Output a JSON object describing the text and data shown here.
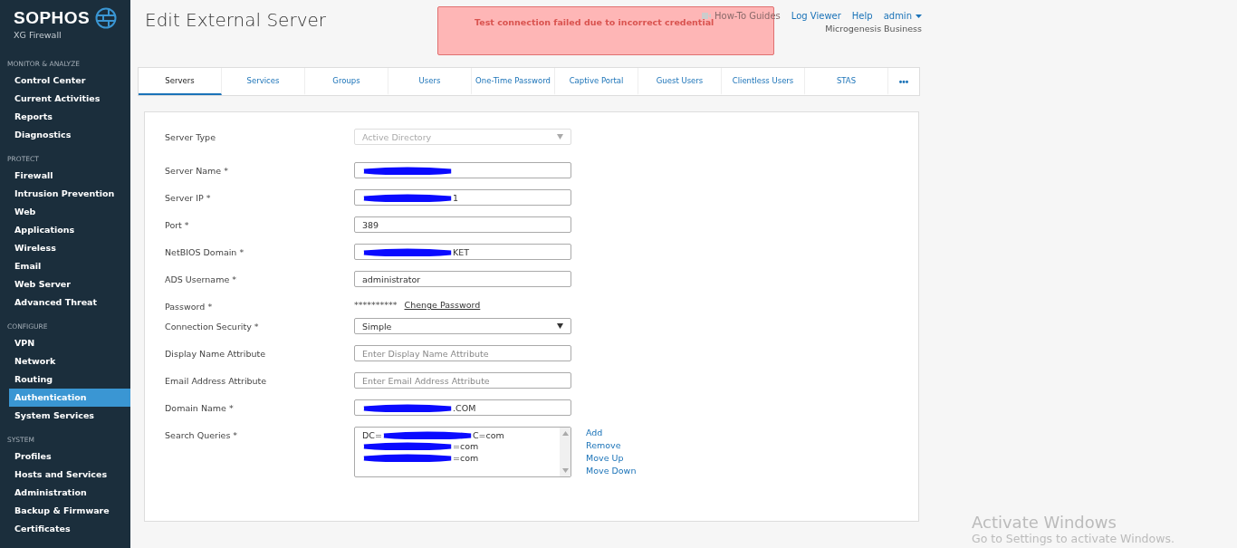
{
  "brand": {
    "name": "SOPHOS",
    "product": "XG Firewall"
  },
  "sidebar": {
    "sections": [
      {
        "title": "MONITOR & ANALYZE",
        "items": [
          {
            "label": "Control Center",
            "selected": false
          },
          {
            "label": "Current Activities",
            "selected": false
          },
          {
            "label": "Reports",
            "selected": false
          },
          {
            "label": "Diagnostics",
            "selected": false
          }
        ]
      },
      {
        "title": "PROTECT",
        "items": [
          {
            "label": "Firewall",
            "selected": false
          },
          {
            "label": "Intrusion Prevention",
            "selected": false
          },
          {
            "label": "Web",
            "selected": false
          },
          {
            "label": "Applications",
            "selected": false
          },
          {
            "label": "Wireless",
            "selected": false
          },
          {
            "label": "Email",
            "selected": false
          },
          {
            "label": "Web Server",
            "selected": false
          },
          {
            "label": "Advanced Threat",
            "selected": false
          }
        ]
      },
      {
        "title": "CONFIGURE",
        "items": [
          {
            "label": "VPN",
            "selected": false
          },
          {
            "label": "Network",
            "selected": false
          },
          {
            "label": "Routing",
            "selected": false
          },
          {
            "label": "Authentication",
            "selected": true
          },
          {
            "label": "System Services",
            "selected": false
          }
        ]
      },
      {
        "title": "SYSTEM",
        "items": [
          {
            "label": "Profiles",
            "selected": false
          },
          {
            "label": "Hosts and Services",
            "selected": false
          },
          {
            "label": "Administration",
            "selected": false
          },
          {
            "label": "Backup & Firmware",
            "selected": false
          },
          {
            "label": "Certificates",
            "selected": false
          }
        ]
      }
    ]
  },
  "page_title": "Edit External Server",
  "header": {
    "links": [
      "How-To Guides",
      "Log Viewer",
      "Help"
    ],
    "user": "admin",
    "company": "Microgenesis Business"
  },
  "toast": {
    "message": "Test connection failed due to incorrect credential"
  },
  "tabs": [
    {
      "label": "Servers",
      "selected": true
    },
    {
      "label": "Services",
      "selected": false
    },
    {
      "label": "Groups",
      "selected": false
    },
    {
      "label": "Users",
      "selected": false
    },
    {
      "label": "One-Time Password",
      "selected": false
    },
    {
      "label": "Captive Portal",
      "selected": false
    },
    {
      "label": "Guest Users",
      "selected": false
    },
    {
      "label": "Clientless Users",
      "selected": false
    },
    {
      "label": "STAS",
      "selected": false
    }
  ],
  "more_tabs": "•••",
  "form": [
    {
      "kind": "select",
      "label": "Server Type",
      "value": "Active Directory",
      "disabled": true
    },
    {
      "kind": "text",
      "label": "Server Name *",
      "parts": [
        {
          "kind": "redacted"
        }
      ]
    },
    {
      "kind": "text",
      "label": "Server IP *",
      "parts": [
        {
          "kind": "redacted"
        },
        {
          "kind": "text",
          "text": "1"
        }
      ]
    },
    {
      "kind": "text",
      "label": "Port *",
      "parts": [
        {
          "kind": "text",
          "text": "389"
        }
      ]
    },
    {
      "kind": "text",
      "label": "NetBIOS Domain *",
      "parts": [
        {
          "kind": "redacted"
        },
        {
          "kind": "text",
          "text": "KET"
        }
      ]
    },
    {
      "kind": "text",
      "label": "ADS Username *",
      "parts": [
        {
          "kind": "text",
          "text": "administrator"
        }
      ]
    },
    {
      "kind": "password",
      "label": "Password *",
      "value": "**********",
      "link": "Chenge Password"
    },
    {
      "kind": "select",
      "label": "Connection Security *",
      "value": "Simple",
      "disabled": false
    },
    {
      "kind": "text",
      "label": "Display Name Attribute",
      "placeholder": "Enter Display Name Attribute"
    },
    {
      "kind": "text",
      "label": "Email Address Attribute",
      "placeholder": "Enter Email Address Attribute"
    },
    {
      "kind": "text",
      "label": "Domain Name *",
      "parts": [
        {
          "kind": "redacted"
        },
        {
          "kind": "text",
          "text": ".COM"
        }
      ]
    },
    {
      "kind": "list",
      "label": "Search Queries *",
      "lines": [
        [
          {
            "kind": "text",
            "text": "DC="
          },
          {
            "kind": "redacted"
          },
          {
            "kind": "text",
            "text": "C=com"
          }
        ],
        [
          {
            "kind": "redacted"
          },
          {
            "kind": "text",
            "text": "=com"
          }
        ],
        [
          {
            "kind": "redacted"
          },
          {
            "kind": "text",
            "text": "=com"
          }
        ]
      ],
      "actions": [
        "Add",
        "Remove",
        "Move Up",
        "Move Down"
      ]
    }
  ],
  "os_notice": {
    "title": "Activate Windows",
    "subtitle": "Go to Settings to activate Windows."
  }
}
